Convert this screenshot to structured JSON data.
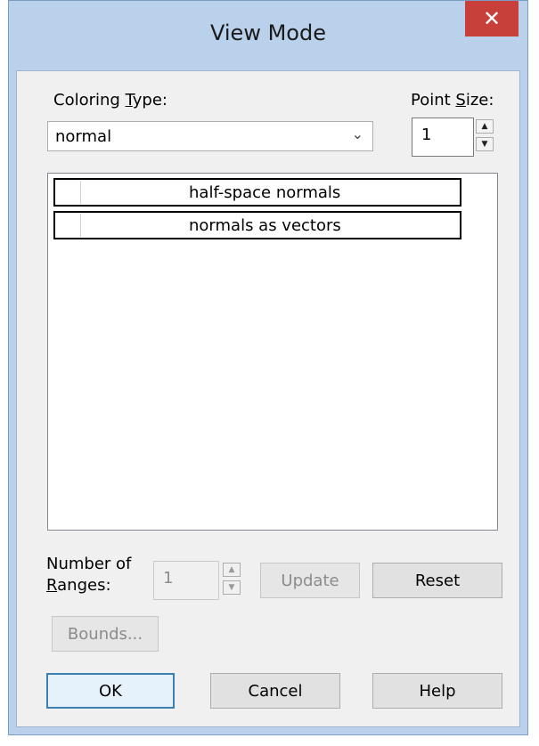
{
  "window": {
    "title": "View Mode",
    "close_icon": "close-icon"
  },
  "coloring_type": {
    "label_prefix": "Coloring ",
    "label_accel": "T",
    "label_suffix": "ype:",
    "selected": "normal"
  },
  "point_size": {
    "label_prefix": "Point ",
    "label_accel": "S",
    "label_suffix": "ize:",
    "value": "1"
  },
  "list": {
    "items": [
      {
        "label": "half-space normals",
        "checked": false
      },
      {
        "label": "normals as vectors",
        "checked": false
      }
    ]
  },
  "ranges": {
    "label_line1": "Number of",
    "label_accel": "R",
    "label_line2_rest": "anges:",
    "value": "1",
    "update_label": "Update",
    "reset_label": "Reset"
  },
  "bounds_label": "Bounds...",
  "footer": {
    "ok_label": "OK",
    "cancel_label": "Cancel",
    "help_label": "Help"
  },
  "colors": {
    "title_bar": "#b9d1ea",
    "close_button": "#c7403a",
    "client": "#f0f0f0",
    "default_button_border": "#3c7fb1"
  }
}
